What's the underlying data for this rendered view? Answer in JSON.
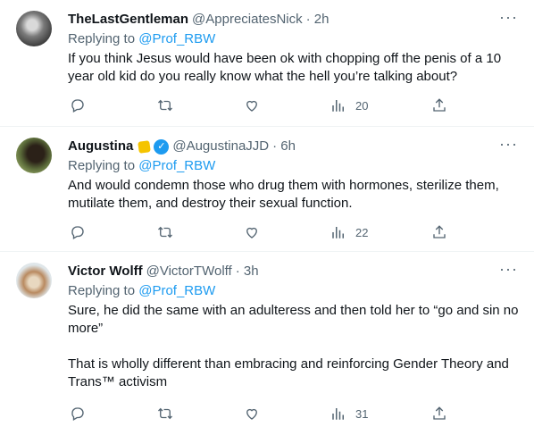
{
  "tweets": [
    {
      "display_name": "TheLastGentleman",
      "handle": "@AppreciatesNick",
      "time": "· 2h",
      "replying_prefix": "Replying to",
      "replying_to": "@Prof_RBW",
      "text": "If you think Jesus would have been ok with chopping off the penis of a 10 year old kid do you really know what the hell you’re talking about?",
      "views": "20"
    },
    {
      "display_name": "Augustina",
      "handle": "@AugustinaJJD",
      "time": "· 6h",
      "replying_prefix": "Replying to",
      "replying_to": "@Prof_RBW",
      "text": "And would condemn those who drug them with hormones, sterilize them, mutilate them, and destroy their sexual function.",
      "views": "22"
    },
    {
      "display_name": "Victor Wolff",
      "handle": "@VictorTWolff",
      "time": "· 3h",
      "replying_prefix": "Replying to",
      "replying_to": "@Prof_RBW",
      "text": "Sure, he did the same with an adulteress and then told her to “go and sin no more”\n\nThat is wholly different than embracing and reinforcing Gender Theory and Trans™ activism",
      "views": "31"
    }
  ],
  "colors": {
    "text": "#0f1419",
    "secondary": "#536471",
    "link": "#1d9bf0",
    "divider": "#eff3f4"
  },
  "icons": [
    "more-icon",
    "reply-icon",
    "retweet-icon",
    "like-icon",
    "views-icon",
    "share-icon",
    "verified-icon",
    "badge-icon"
  ]
}
